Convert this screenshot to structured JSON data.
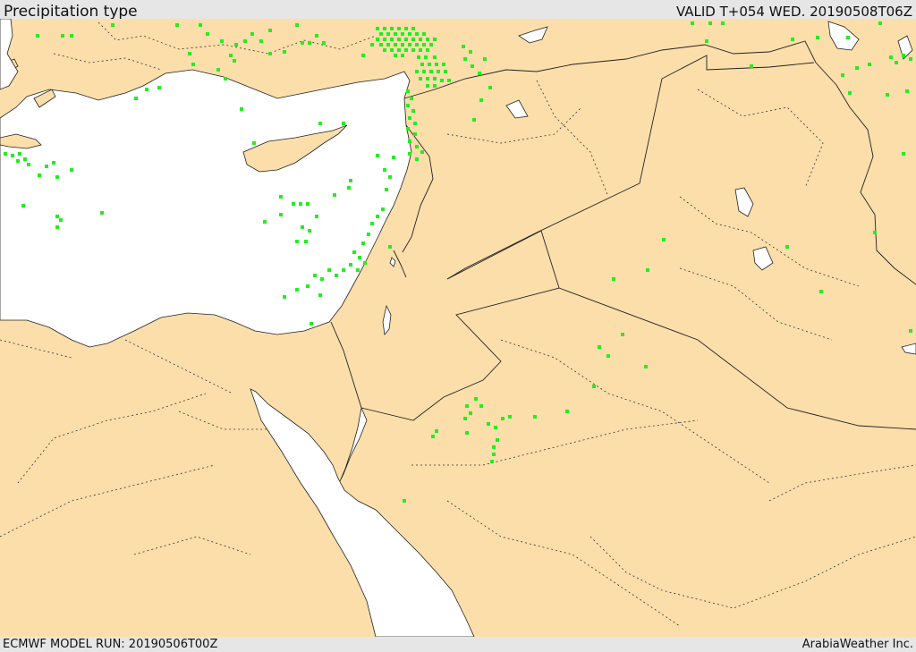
{
  "header": {
    "title": "Precipitation type",
    "valid_time": "VALID T+054 WED. 20190508T06Z"
  },
  "footer": {
    "model_run": "ECMWF MODEL RUN: 20190506T00Z",
    "credit": "ArabiaWeather Inc."
  },
  "map": {
    "land_color": "#fcdeaa",
    "water_color": "#ffffff",
    "border_color": "#222222",
    "precip_rain_color": "#22ee22"
  }
}
